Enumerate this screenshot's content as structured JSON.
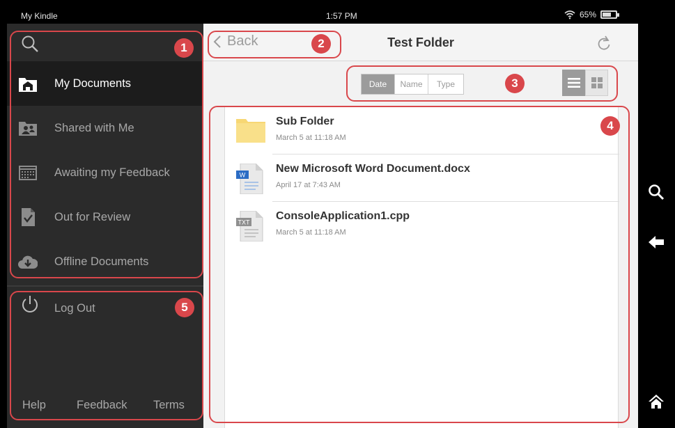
{
  "status_bar": {
    "device_name": "My Kindle",
    "time": "1:57 PM",
    "battery": "65%",
    "battery_level": 0.65
  },
  "sidebar": {
    "search_icon": "search-icon",
    "items": [
      {
        "label": "My Documents",
        "icon": "home-folder-icon",
        "active": true
      },
      {
        "label": "Shared with Me",
        "icon": "shared-users-icon",
        "active": false
      },
      {
        "label": "Awaiting my Feedback",
        "icon": "calendar-icon",
        "active": false
      },
      {
        "label": "Out for Review",
        "icon": "document-check-icon",
        "active": false
      },
      {
        "label": "Offline Documents",
        "icon": "cloud-download-icon",
        "active": false
      }
    ],
    "logout_label": "Log Out",
    "footer": {
      "help": "Help",
      "feedback": "Feedback",
      "terms": "Terms"
    }
  },
  "header": {
    "back_label": "Back",
    "title": "Test Folder"
  },
  "sort": {
    "options": [
      "Date",
      "Name",
      "Type"
    ],
    "selected": "Date",
    "view_mode": "list"
  },
  "files": [
    {
      "name": "Sub Folder",
      "date": "March 5 at 11:18 AM",
      "icon": "folder-icon"
    },
    {
      "name": "New Microsoft Word Document.docx",
      "date": "April 17 at 7:43 AM",
      "icon": "word-doc-icon"
    },
    {
      "name": "ConsoleApplication1.cpp",
      "date": "March 5 at 11:18 AM",
      "icon": "text-file-icon"
    }
  ],
  "annotations": [
    "1",
    "2",
    "3",
    "4",
    "5"
  ],
  "colors": {
    "annotation": "#d9474b",
    "sidebar_bg": "#2b2b2b",
    "sidebar_active_bg": "#1c1c1c",
    "main_bg": "#f2f2f2",
    "folder": "#f7d774",
    "word_blue": "#2b6cc4"
  }
}
